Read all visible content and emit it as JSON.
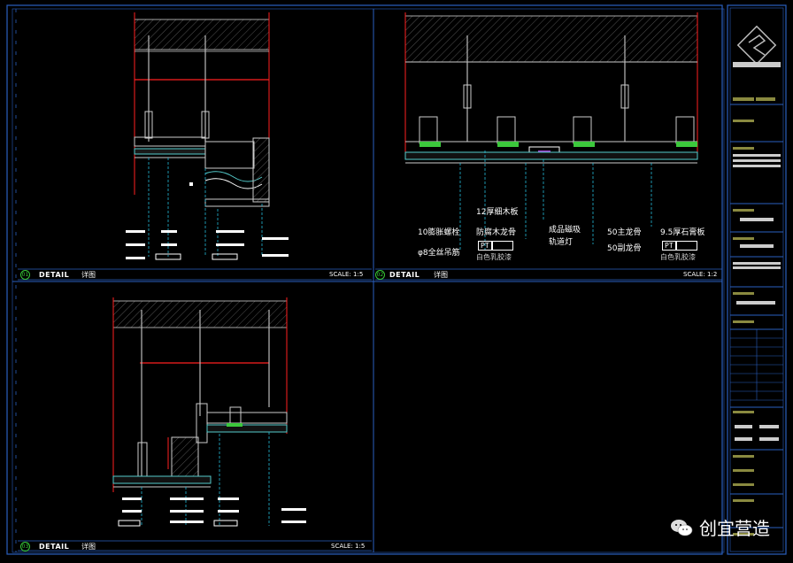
{
  "panels": [
    {
      "num": "01",
      "detail": "DETAIL",
      "subtitle": "详图",
      "scale": "SCALE: 1:5"
    },
    {
      "num": "02",
      "detail": "DETAIL",
      "subtitle": "详图",
      "scale": "SCALE: 1:2"
    },
    {
      "num": "03",
      "detail": "DETAIL",
      "subtitle": "详图",
      "scale": "SCALE: 1:5"
    }
  ],
  "panel2_labels": {
    "l1": "12厚细木板",
    "l2": "10膨胀螺栓",
    "l3": "防腐木龙骨",
    "l4": "成品磁吸",
    "l5": "轨道灯",
    "l6": "50主龙骨",
    "l7": "9.5厚石膏板",
    "l8": "φ8全丝吊筋",
    "l9": "50副龙骨",
    "pt1": "PT",
    "pt2": "PT",
    "paint1": "白色乳胶漆",
    "paint2": "白色乳胶漆"
  },
  "watermark": "创宜营造",
  "colors": {
    "frame": "#2a5fbf",
    "accent": "#ff2020",
    "cyan": "#25b8d8",
    "green": "#3cc83c"
  }
}
